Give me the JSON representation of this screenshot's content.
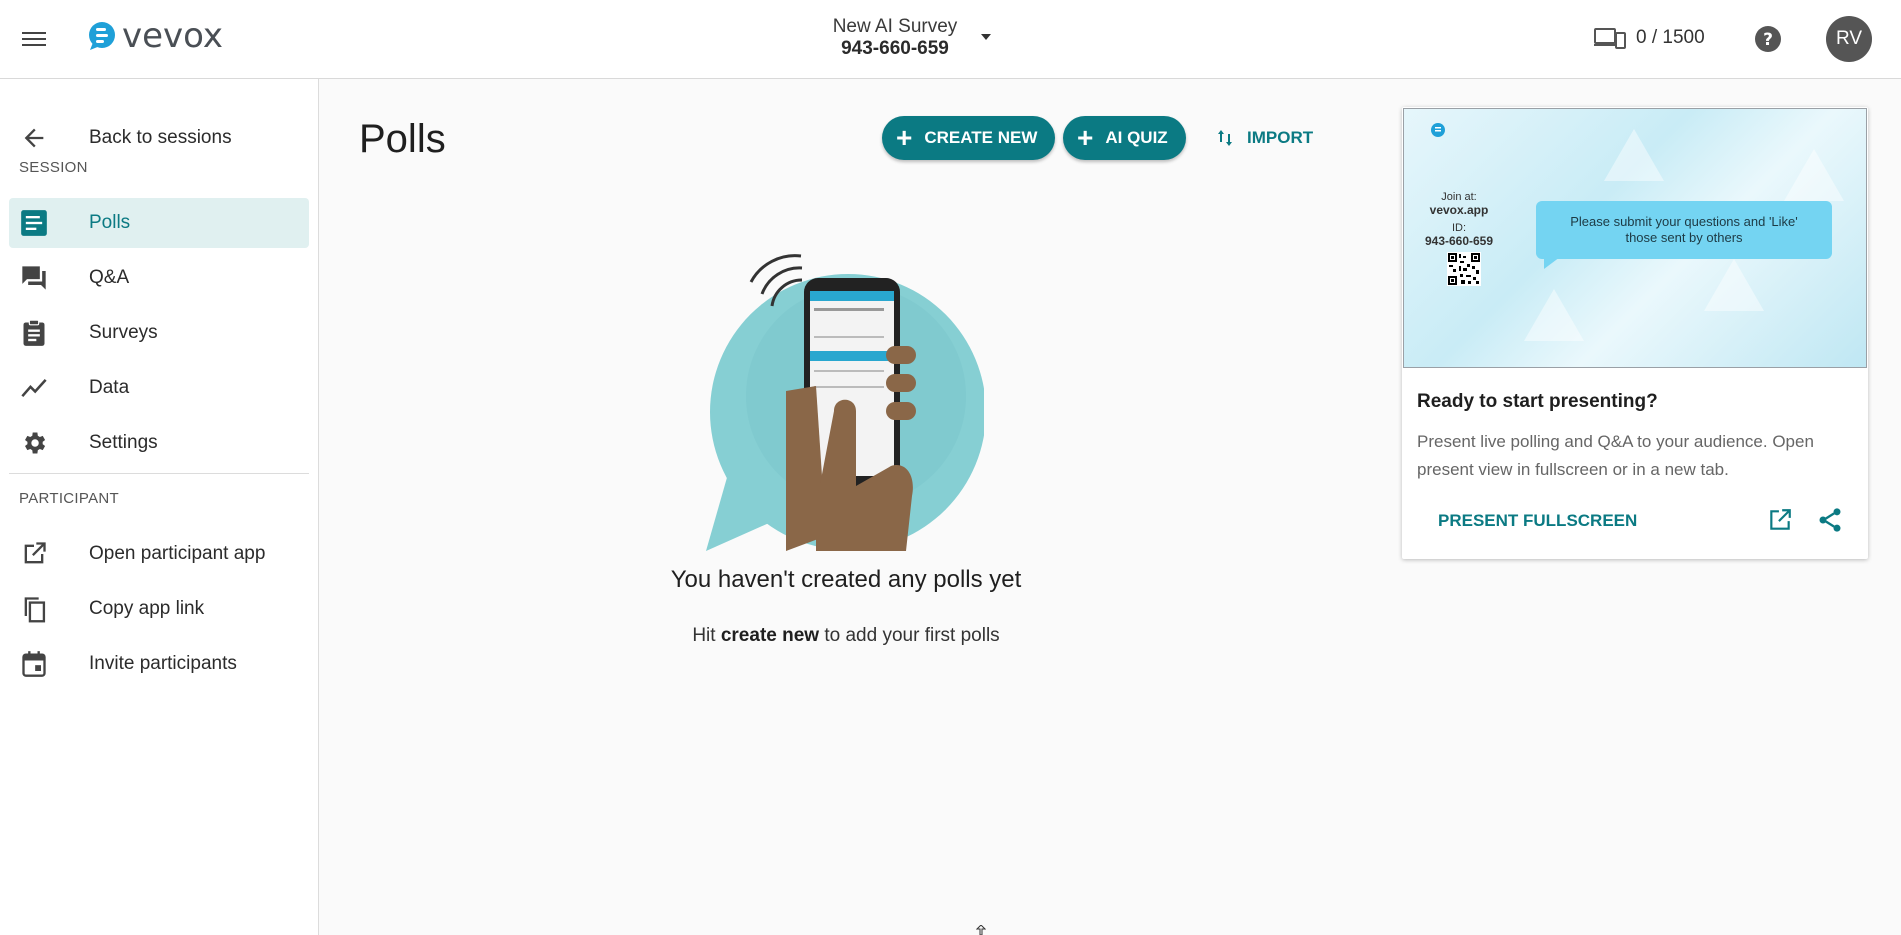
{
  "header": {
    "logo_text": "vevox",
    "session_name": "New AI Survey",
    "session_id": "943-660-659",
    "devices_count": "0 / 1500",
    "avatar_initials": "RV"
  },
  "sidebar": {
    "back_label": "Back to sessions",
    "session_section": "SESSION",
    "items": [
      {
        "label": "Polls",
        "icon": "polls-icon"
      },
      {
        "label": "Q&A",
        "icon": "qa-chat-icon"
      },
      {
        "label": "Surveys",
        "icon": "clipboard-icon"
      },
      {
        "label": "Data",
        "icon": "line-chart-icon"
      },
      {
        "label": "Settings",
        "icon": "gear-icon"
      }
    ],
    "participant_section": "PARTICIPANT",
    "participant_items": [
      {
        "label": "Open participant app",
        "icon": "open-external-icon"
      },
      {
        "label": "Copy app link",
        "icon": "copy-icon"
      },
      {
        "label": "Invite participants",
        "icon": "calendar-icon"
      }
    ]
  },
  "main": {
    "title": "Polls",
    "create_new_label": "CREATE NEW",
    "ai_quiz_label": "AI QUIZ",
    "import_label": "IMPORT",
    "empty_heading": "You haven't created any polls yet",
    "empty_sub_prefix": "Hit",
    "empty_sub_bold": "create new",
    "empty_sub_suffix": "to add your first polls"
  },
  "present_card": {
    "preview_join_at": "Join at:",
    "preview_url": "vevox.app",
    "preview_id_label": "ID:",
    "preview_id": "943-660-659",
    "preview_bubble": "Please submit your questions and 'Like' those sent by others",
    "title": "Ready to start presenting?",
    "description": "Present live polling and Q&A to your audience. Open present view in fullscreen or in a new tab.",
    "present_fullscreen_label": "PRESENT FULLSCREEN"
  },
  "colors": {
    "accent": "#0b7a83",
    "active_nav_bg": "#e0f0f0",
    "bubble": "#74d4f2"
  }
}
